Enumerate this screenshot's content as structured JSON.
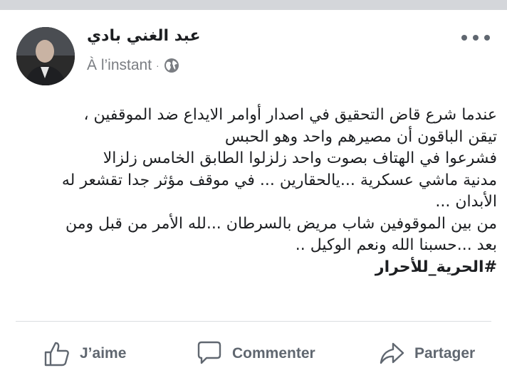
{
  "post": {
    "author": "عبد الغني بادي",
    "timestamp": "À l’instant",
    "separator": "·",
    "privacy_icon": "globe-icon",
    "more_icon": "more-options-icon",
    "lines": [
      "عندما شرع قاض التحقيق في اصدار أوامر الايداع ضد الموقفين ،",
      "تيقن الباقون أن مصيرهم واحد وهو الحبس",
      "فشرعوا في الهتاف بصوت واحد زلزلوا الطابق الخامس زلزالا",
      "مدنية ماشي عسكرية ...يالحقارين ... في موقف مؤثر جدا تقشعر له",
      "الأبدان ...",
      "من بين الموقوفين شاب مريض بالسرطان ...لله الأمر من قبل ومن",
      "بعد ...حسبنا الله ونعم الوكيل .."
    ],
    "hashtag": "#الحرية_للأحرار"
  },
  "actions": {
    "like_label": "J’aime",
    "comment_label": "Commenter",
    "share_label": "Partager"
  },
  "colors": {
    "background": "#e9ebee",
    "card": "#ffffff",
    "text": "#1c1e21",
    "secondary": "#606770",
    "muted": "#7a7d82",
    "divider": "#dadde1"
  }
}
